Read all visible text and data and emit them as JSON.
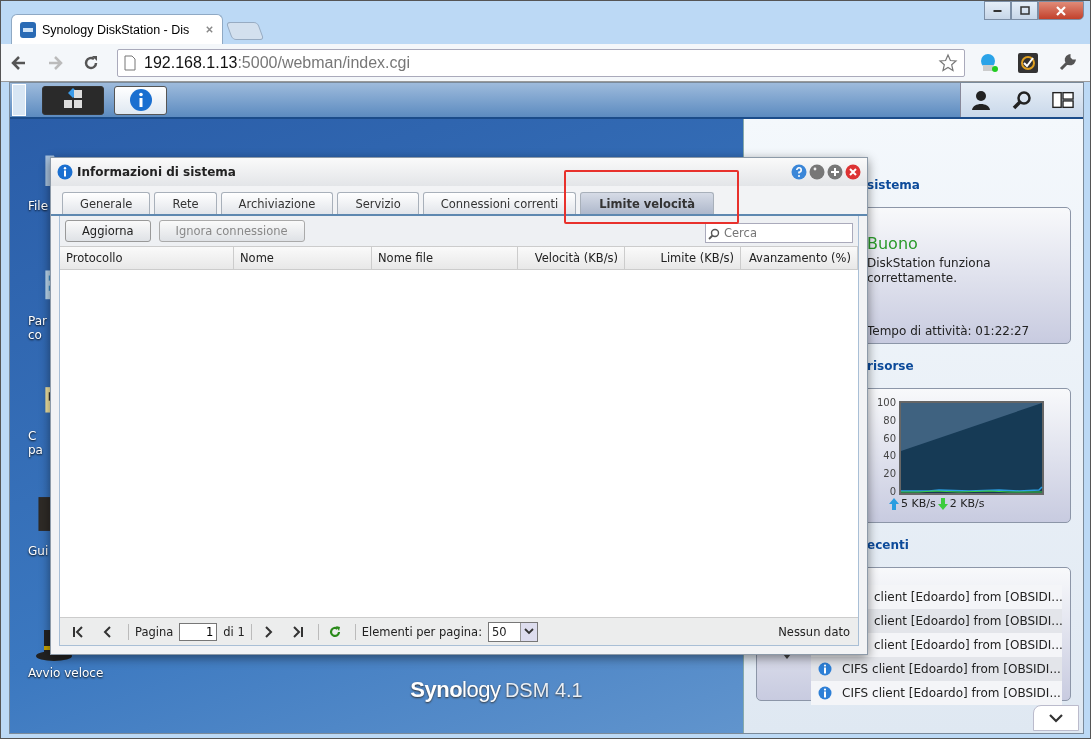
{
  "browser": {
    "tab_title": "Synology DiskStation - Dis",
    "url_host": "192.168.1.13",
    "url_path": ":5000/webman/index.cgi"
  },
  "taskbar": {
    "buttons": [
      {
        "kind": "main-menu",
        "selected": false
      },
      {
        "kind": "info",
        "selected": true
      }
    ]
  },
  "desktop_icons": [
    {
      "kind": "folder",
      "lines": [
        "File"
      ]
    },
    {
      "kind": "panel",
      "lines": [
        "Par",
        "co"
      ]
    },
    {
      "kind": "package",
      "lines": [
        "C",
        "pa"
      ]
    },
    {
      "kind": "book",
      "lines": [
        "Gui"
      ]
    },
    {
      "kind": "hat",
      "lines": [
        "Avvio veloce"
      ]
    }
  ],
  "dialog": {
    "title": "Informazioni di sistema",
    "tabs": [
      {
        "label": "Generale",
        "selected": false
      },
      {
        "label": "Rete",
        "selected": false
      },
      {
        "label": "Archiviazione",
        "selected": false
      },
      {
        "label": "Servizio",
        "selected": false
      },
      {
        "label": "Connessioni correnti",
        "selected": false
      },
      {
        "label": "Limite velocità",
        "selected": true
      }
    ],
    "toolbar_buttons": [
      {
        "label": "Aggiorna",
        "disabled": false
      },
      {
        "label": "Ignora connessione",
        "disabled": true
      }
    ],
    "search": {
      "placeholder": "Cerca"
    },
    "columns": [
      "Protocollo",
      "Nome",
      "Nome file",
      "Velocità (KB/s)",
      "Limite (KB/s)",
      "Avanzamento (%)"
    ],
    "pager": {
      "page_label": "Pagina",
      "page": "1",
      "of": "di 1",
      "per_page_label": "Elementi per pagina:",
      "per_page": "50",
      "status": "Nessun dato"
    }
  },
  "widgets": {
    "health": {
      "heading": "sistema",
      "status": "Buono",
      "lines": [
        "DiskStation funziona",
        "correttamente."
      ],
      "uptime": "Tempo di attività: 01:22:27"
    },
    "resources": {
      "heading": "risorse",
      "upload": "5 KB/s",
      "download": "2 KB/s",
      "axis_labels": [
        "100",
        "80",
        "60",
        "40",
        "20",
        "0"
      ]
    },
    "logs": {
      "heading": "ecenti",
      "rows": [
        {
          "kind": "partial",
          "text": "client [Edoardo] from [OBSIDI..."
        },
        {
          "kind": "partial",
          "text": "client [Edoardo] from [OBSIDI..."
        },
        {
          "kind": "partial",
          "text": "client [Edoardo] from [OBSIDI..."
        },
        {
          "kind": "info",
          "text": "CIFS client [Edoardo] from [OBSIDI..."
        },
        {
          "kind": "info",
          "text": "CIFS client [Edoardo] from [OBSIDI..."
        }
      ]
    }
  },
  "logo": {
    "brand": "**Syno**logy",
    "version": "DSM 4.1"
  }
}
